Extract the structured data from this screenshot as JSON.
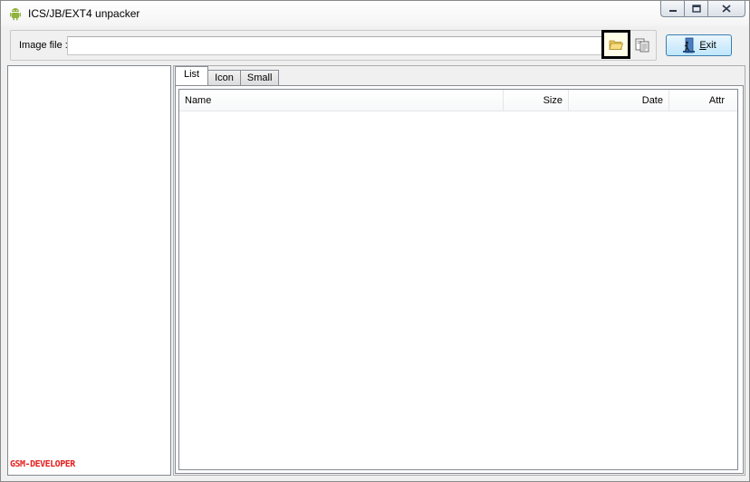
{
  "window": {
    "title": "ICS/JB/EXT4 unpacker",
    "app_icon": "android-icon",
    "caption_buttons": {
      "minimize": "minimize-icon",
      "maximize": "maximize-icon",
      "close": "close-icon"
    }
  },
  "toolbar": {
    "image_label": "Image file :",
    "image_value": "",
    "open_icon": "folder-open-icon",
    "extract_icon": "extract-icon",
    "exit_label_prefix": "",
    "exit_label_underlined": "E",
    "exit_label_rest": "xit",
    "exit_icon": "exit-door-icon"
  },
  "left_panel": {
    "watermark": "GSM-DEVELOPER"
  },
  "tabs": [
    {
      "label": "List",
      "active": true
    },
    {
      "label": "Icon",
      "active": false
    },
    {
      "label": "Small",
      "active": false
    }
  ],
  "listview": {
    "columns": [
      "Name",
      "Size",
      "Date",
      "Attr"
    ],
    "rows": []
  },
  "colors": {
    "window_bg": "#f0f0f0",
    "watermark": "#e31e1e",
    "exit_button_border": "#3c7fb1"
  }
}
